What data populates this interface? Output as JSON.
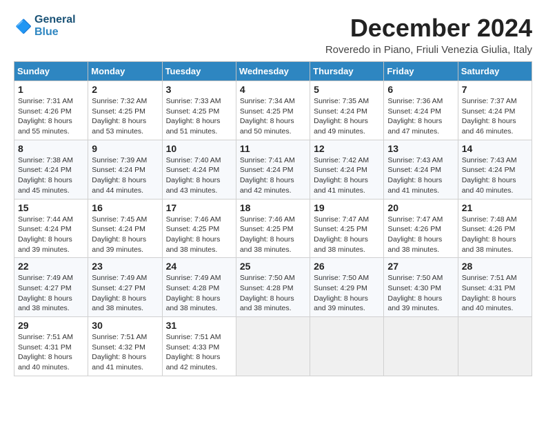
{
  "header": {
    "logo_general": "General",
    "logo_blue": "Blue",
    "month_title": "December 2024",
    "location": "Roveredo in Piano, Friuli Venezia Giulia, Italy"
  },
  "weekdays": [
    "Sunday",
    "Monday",
    "Tuesday",
    "Wednesday",
    "Thursday",
    "Friday",
    "Saturday"
  ],
  "weeks": [
    [
      {
        "day": 1,
        "sunrise": "Sunrise: 7:31 AM",
        "sunset": "Sunset: 4:26 PM",
        "daylight": "Daylight: 8 hours and 55 minutes."
      },
      {
        "day": 2,
        "sunrise": "Sunrise: 7:32 AM",
        "sunset": "Sunset: 4:25 PM",
        "daylight": "Daylight: 8 hours and 53 minutes."
      },
      {
        "day": 3,
        "sunrise": "Sunrise: 7:33 AM",
        "sunset": "Sunset: 4:25 PM",
        "daylight": "Daylight: 8 hours and 51 minutes."
      },
      {
        "day": 4,
        "sunrise": "Sunrise: 7:34 AM",
        "sunset": "Sunset: 4:25 PM",
        "daylight": "Daylight: 8 hours and 50 minutes."
      },
      {
        "day": 5,
        "sunrise": "Sunrise: 7:35 AM",
        "sunset": "Sunset: 4:24 PM",
        "daylight": "Daylight: 8 hours and 49 minutes."
      },
      {
        "day": 6,
        "sunrise": "Sunrise: 7:36 AM",
        "sunset": "Sunset: 4:24 PM",
        "daylight": "Daylight: 8 hours and 47 minutes."
      },
      {
        "day": 7,
        "sunrise": "Sunrise: 7:37 AM",
        "sunset": "Sunset: 4:24 PM",
        "daylight": "Daylight: 8 hours and 46 minutes."
      }
    ],
    [
      {
        "day": 8,
        "sunrise": "Sunrise: 7:38 AM",
        "sunset": "Sunset: 4:24 PM",
        "daylight": "Daylight: 8 hours and 45 minutes."
      },
      {
        "day": 9,
        "sunrise": "Sunrise: 7:39 AM",
        "sunset": "Sunset: 4:24 PM",
        "daylight": "Daylight: 8 hours and 44 minutes."
      },
      {
        "day": 10,
        "sunrise": "Sunrise: 7:40 AM",
        "sunset": "Sunset: 4:24 PM",
        "daylight": "Daylight: 8 hours and 43 minutes."
      },
      {
        "day": 11,
        "sunrise": "Sunrise: 7:41 AM",
        "sunset": "Sunset: 4:24 PM",
        "daylight": "Daylight: 8 hours and 42 minutes."
      },
      {
        "day": 12,
        "sunrise": "Sunrise: 7:42 AM",
        "sunset": "Sunset: 4:24 PM",
        "daylight": "Daylight: 8 hours and 41 minutes."
      },
      {
        "day": 13,
        "sunrise": "Sunrise: 7:43 AM",
        "sunset": "Sunset: 4:24 PM",
        "daylight": "Daylight: 8 hours and 41 minutes."
      },
      {
        "day": 14,
        "sunrise": "Sunrise: 7:43 AM",
        "sunset": "Sunset: 4:24 PM",
        "daylight": "Daylight: 8 hours and 40 minutes."
      }
    ],
    [
      {
        "day": 15,
        "sunrise": "Sunrise: 7:44 AM",
        "sunset": "Sunset: 4:24 PM",
        "daylight": "Daylight: 8 hours and 39 minutes."
      },
      {
        "day": 16,
        "sunrise": "Sunrise: 7:45 AM",
        "sunset": "Sunset: 4:24 PM",
        "daylight": "Daylight: 8 hours and 39 minutes."
      },
      {
        "day": 17,
        "sunrise": "Sunrise: 7:46 AM",
        "sunset": "Sunset: 4:25 PM",
        "daylight": "Daylight: 8 hours and 38 minutes."
      },
      {
        "day": 18,
        "sunrise": "Sunrise: 7:46 AM",
        "sunset": "Sunset: 4:25 PM",
        "daylight": "Daylight: 8 hours and 38 minutes."
      },
      {
        "day": 19,
        "sunrise": "Sunrise: 7:47 AM",
        "sunset": "Sunset: 4:25 PM",
        "daylight": "Daylight: 8 hours and 38 minutes."
      },
      {
        "day": 20,
        "sunrise": "Sunrise: 7:47 AM",
        "sunset": "Sunset: 4:26 PM",
        "daylight": "Daylight: 8 hours and 38 minutes."
      },
      {
        "day": 21,
        "sunrise": "Sunrise: 7:48 AM",
        "sunset": "Sunset: 4:26 PM",
        "daylight": "Daylight: 8 hours and 38 minutes."
      }
    ],
    [
      {
        "day": 22,
        "sunrise": "Sunrise: 7:49 AM",
        "sunset": "Sunset: 4:27 PM",
        "daylight": "Daylight: 8 hours and 38 minutes."
      },
      {
        "day": 23,
        "sunrise": "Sunrise: 7:49 AM",
        "sunset": "Sunset: 4:27 PM",
        "daylight": "Daylight: 8 hours and 38 minutes."
      },
      {
        "day": 24,
        "sunrise": "Sunrise: 7:49 AM",
        "sunset": "Sunset: 4:28 PM",
        "daylight": "Daylight: 8 hours and 38 minutes."
      },
      {
        "day": 25,
        "sunrise": "Sunrise: 7:50 AM",
        "sunset": "Sunset: 4:28 PM",
        "daylight": "Daylight: 8 hours and 38 minutes."
      },
      {
        "day": 26,
        "sunrise": "Sunrise: 7:50 AM",
        "sunset": "Sunset: 4:29 PM",
        "daylight": "Daylight: 8 hours and 39 minutes."
      },
      {
        "day": 27,
        "sunrise": "Sunrise: 7:50 AM",
        "sunset": "Sunset: 4:30 PM",
        "daylight": "Daylight: 8 hours and 39 minutes."
      },
      {
        "day": 28,
        "sunrise": "Sunrise: 7:51 AM",
        "sunset": "Sunset: 4:31 PM",
        "daylight": "Daylight: 8 hours and 40 minutes."
      }
    ],
    [
      {
        "day": 29,
        "sunrise": "Sunrise: 7:51 AM",
        "sunset": "Sunset: 4:31 PM",
        "daylight": "Daylight: 8 hours and 40 minutes."
      },
      {
        "day": 30,
        "sunrise": "Sunrise: 7:51 AM",
        "sunset": "Sunset: 4:32 PM",
        "daylight": "Daylight: 8 hours and 41 minutes."
      },
      {
        "day": 31,
        "sunrise": "Sunrise: 7:51 AM",
        "sunset": "Sunset: 4:33 PM",
        "daylight": "Daylight: 8 hours and 42 minutes."
      },
      null,
      null,
      null,
      null
    ]
  ]
}
